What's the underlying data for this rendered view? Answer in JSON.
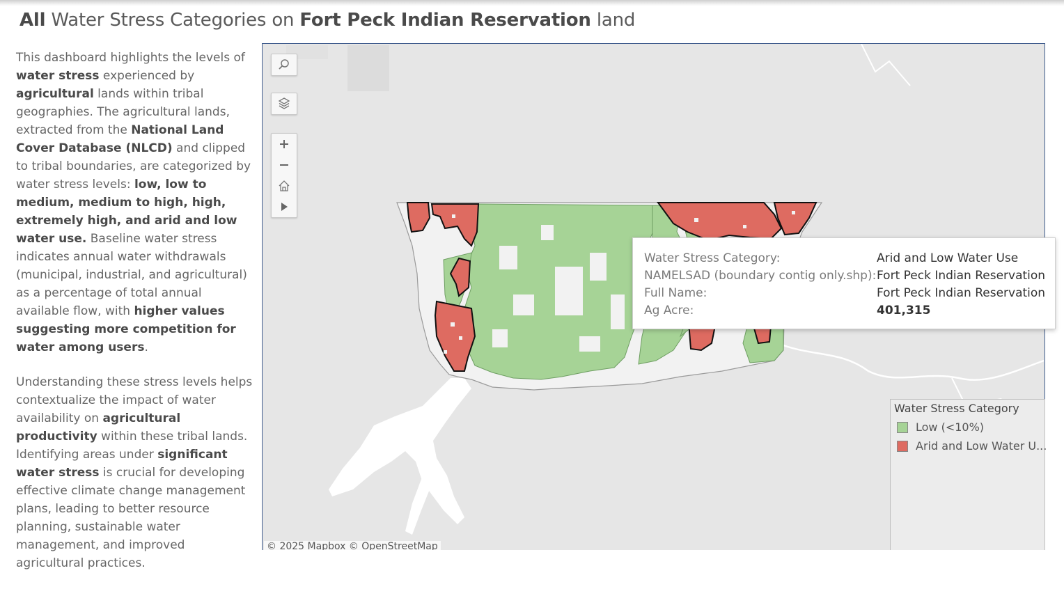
{
  "title": {
    "lead": "All",
    "mid1": "Water Stress Categories on",
    "place": "Fort Peck Indian Reservation",
    "tail": "land"
  },
  "description": {
    "p1": [
      {
        "text": "This dashboard highlights the levels of ",
        "bold": false
      },
      {
        "text": "water stress",
        "bold": true
      },
      {
        "text": " experienced by ",
        "bold": false
      },
      {
        "text": "agricultural",
        "bold": true
      },
      {
        "text": " lands within tribal geographies. The agricultural lands, extracted from the ",
        "bold": false
      },
      {
        "text": "National Land Cover Database (NLCD)",
        "bold": true
      },
      {
        "text": " and clipped to tribal boundaries, are categorized by water stress levels: ",
        "bold": false
      },
      {
        "text": "low, low to medium, medium to high, high, extremely high, and arid and low water use.",
        "bold": true
      },
      {
        "text": " Baseline water stress indicates annual water withdrawals (municipal, industrial, and agricultural) as a percentage of total annual available flow, with ",
        "bold": false
      },
      {
        "text": "higher values suggesting more competition for water among users",
        "bold": true
      },
      {
        "text": ".",
        "bold": false
      }
    ],
    "p2": [
      {
        "text": "Understanding these stress levels helps contextualize the impact of water availability on ",
        "bold": false
      },
      {
        "text": "agricultural productivity",
        "bold": true
      },
      {
        "text": " within these tribal lands. Identifying areas under ",
        "bold": false
      },
      {
        "text": "significant water stress",
        "bold": true
      },
      {
        "text": " is crucial for developing effective climate change management plans, leading to better resource planning, sustainable water management, and improved agricultural practices.",
        "bold": false
      }
    ]
  },
  "map": {
    "controls": [
      {
        "name": "search-icon"
      },
      {
        "name": "layers-icon"
      },
      {
        "name": "zoom-in-icon"
      },
      {
        "name": "zoom-out-icon"
      },
      {
        "name": "home-icon"
      },
      {
        "name": "play-icon"
      }
    ],
    "attribution": "© 2025 Mapbox  © OpenStreetMap",
    "colors": {
      "low": "#a6d396",
      "arid": "#de6b61",
      "background": "#e6e6e6",
      "boundary": "#f2f2f2"
    }
  },
  "tooltip": {
    "rows": [
      {
        "label": "Water Stress Category:",
        "value": "Arid and Low Water Use"
      },
      {
        "label": "NAMELSAD (boundary contig only.shp):",
        "value": "Fort Peck Indian Reservation"
      },
      {
        "label": "Full Name:",
        "value": "Fort Peck Indian Reservation"
      },
      {
        "label": "Ag Acre:",
        "value": "401,315"
      }
    ]
  },
  "legend": {
    "title": "Water Stress Category",
    "items": [
      {
        "label": "Low (<10%)",
        "color": "#a6d396"
      },
      {
        "label": "Arid and Low Water U...",
        "color": "#de6b61"
      }
    ]
  }
}
